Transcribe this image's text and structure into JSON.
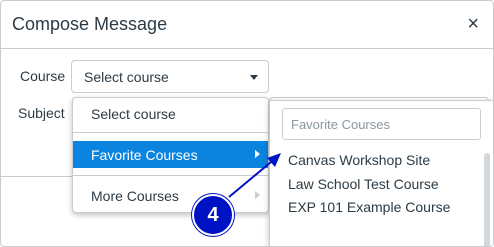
{
  "dialog": {
    "title": "Compose Message",
    "close_glyph": "×"
  },
  "form": {
    "course_label": "Course",
    "course_select_value": "Select course",
    "subject_label": "Subject"
  },
  "course_menu": {
    "items": [
      {
        "label": "Select course",
        "submenu": false
      },
      {
        "label": "Favorite Courses",
        "submenu": true,
        "highlighted": true
      },
      {
        "label": "More Courses",
        "submenu": true
      }
    ],
    "highlight_color": "#0b84e0"
  },
  "submenu": {
    "search_placeholder": "Favorite Courses",
    "items": [
      "Canvas Workshop Site",
      "Law School Test Course",
      "EXP 101 Example Course"
    ]
  },
  "annotation": {
    "step_number": "4",
    "badge_color": "#0013c4"
  },
  "icons": {
    "close": "close-icon",
    "dropdown": "caret-down-icon",
    "submenu": "caret-right-icon"
  }
}
